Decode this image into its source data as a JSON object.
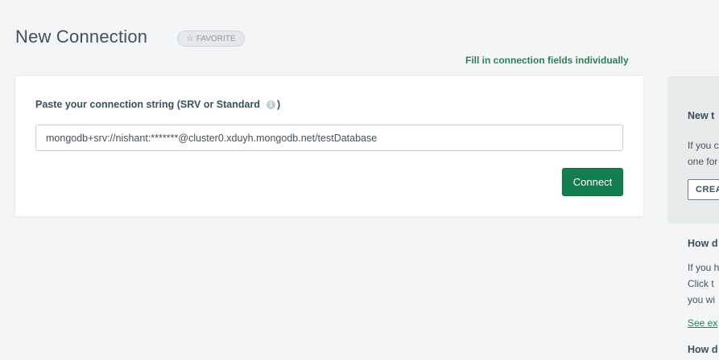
{
  "page": {
    "title": "New Connection",
    "favorite_label": "FAVORITE",
    "fill_fields_link": "Fill in connection fields individually"
  },
  "connection": {
    "label": "Paste your connection string (SRV or Standard",
    "label_close": ")",
    "value": "mongodb+srv://nishant:*******@cluster0.xduyh.mongodb.net/testDatabase",
    "connect_label": "Connect"
  },
  "side_panel": {
    "heading": "New t",
    "text_lines": [
      "If you c",
      "one for"
    ],
    "create_label": "CREA"
  },
  "side_lower": {
    "heading": "How d",
    "text_lines": [
      "If you h",
      "Click t",
      "you wi"
    ],
    "link": "See ex",
    "heading2": "How d"
  },
  "colors": {
    "accent": "#137d4f",
    "link": "#2f7d5b",
    "background": "#f4f5f6"
  }
}
